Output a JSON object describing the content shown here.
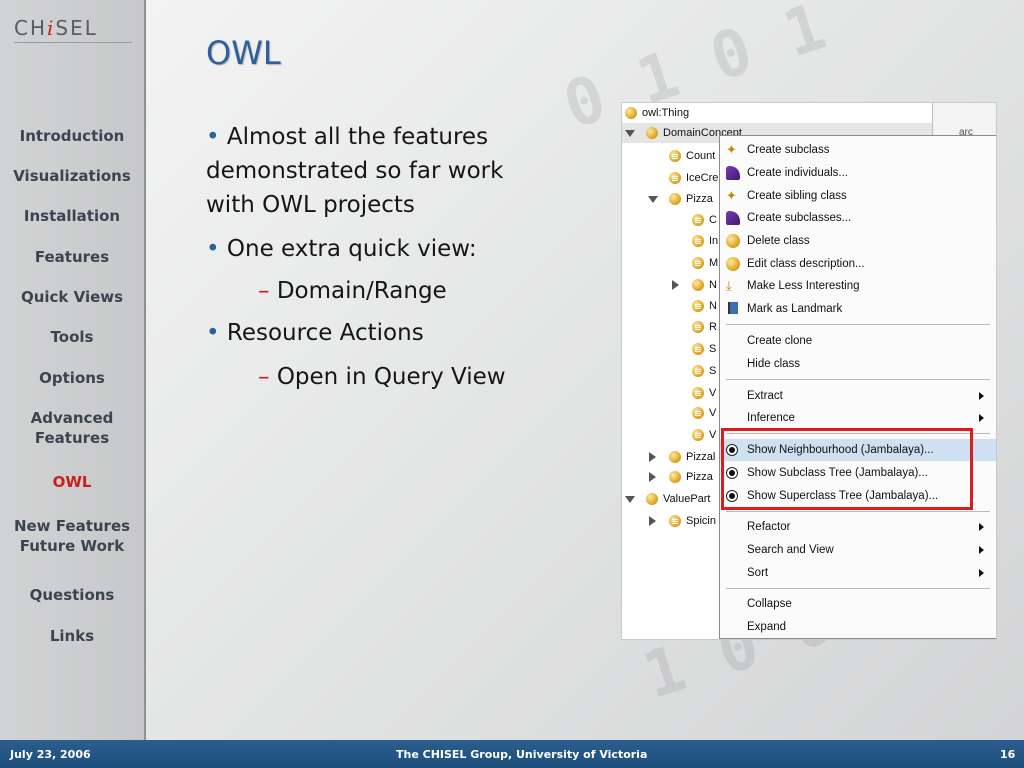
{
  "logo": {
    "text_a": "CH",
    "text_i": "i",
    "text_b": "SEL"
  },
  "sidebar": {
    "items": [
      {
        "label": "Introduction"
      },
      {
        "label": "Visualizations"
      },
      {
        "label": "Installation"
      },
      {
        "label": "Features"
      },
      {
        "label": "Quick Views"
      },
      {
        "label": "Tools"
      },
      {
        "label": "Options"
      },
      {
        "label": "Advanced Features"
      },
      {
        "label": "OWL",
        "active": true
      },
      {
        "label": "New Features Future Work"
      },
      {
        "label": "Questions"
      },
      {
        "label": "Links"
      }
    ]
  },
  "slide": {
    "title": "OWL",
    "bullets": [
      {
        "level": 1,
        "text": "Almost all the features demonstrated so far work with OWL projects"
      },
      {
        "level": 1,
        "text": "One extra quick view:"
      },
      {
        "level": 2,
        "text": "Domain/Range"
      },
      {
        "level": 1,
        "text": "Resource Actions"
      },
      {
        "level": 2,
        "text": "Open in Query View"
      }
    ],
    "bullet_glyph": "•",
    "sub_glyph": "–"
  },
  "tree": {
    "rows": [
      {
        "label": "owl:Thing",
        "expander": "none"
      },
      {
        "label": "DomainConcept",
        "expander": "down"
      },
      {
        "label": "Count",
        "expander": "none"
      },
      {
        "label": "IceCre",
        "expander": "none"
      },
      {
        "label": "Pizza",
        "expander": "down"
      },
      {
        "label": "C",
        "expander": "none"
      },
      {
        "label": "In",
        "expander": "none"
      },
      {
        "label": "M",
        "expander": "none"
      },
      {
        "label": "N",
        "expander": "right"
      },
      {
        "label": "N",
        "expander": "none"
      },
      {
        "label": "R",
        "expander": "none"
      },
      {
        "label": "S",
        "expander": "none"
      },
      {
        "label": "S",
        "expander": "none"
      },
      {
        "label": "V",
        "expander": "none"
      },
      {
        "label": "V",
        "expander": "none"
      },
      {
        "label": "V",
        "expander": "none"
      },
      {
        "label": "Pizzal",
        "expander": "right"
      },
      {
        "label": "Pizza",
        "expander": "right"
      },
      {
        "label": "ValuePart",
        "expander": "down"
      },
      {
        "label": "Spicin",
        "expander": "right"
      }
    ],
    "right_pane_text": "arc"
  },
  "context_menu": {
    "items": [
      {
        "label": "Create subclass",
        "icon": "star-ball-icon"
      },
      {
        "label": "Create individuals...",
        "icon": "wizard-hat-icon"
      },
      {
        "label": "Create sibling class",
        "icon": "star-ball-icon"
      },
      {
        "label": "Create subclasses...",
        "icon": "wizard-hat-icon"
      },
      {
        "label": "Delete class",
        "icon": "delete-ball-icon"
      },
      {
        "label": "Edit class description...",
        "icon": "ball-icon"
      },
      {
        "label": "Make Less Interesting",
        "icon": "less-interesting-icon"
      },
      {
        "label": "Mark as Landmark",
        "icon": "landmark-flag-icon"
      },
      {
        "label": "Create clone"
      },
      {
        "label": "Hide class"
      },
      {
        "label": "Extract",
        "submenu": true
      },
      {
        "label": "Inference",
        "submenu": true
      },
      {
        "label": "Show Neighbourhood (Jambalaya)...",
        "icon": "radio-icon",
        "highlighted": true
      },
      {
        "label": "Show Subclass Tree (Jambalaya)...",
        "icon": "radio-icon"
      },
      {
        "label": "Show Superclass Tree (Jambalaya)...",
        "icon": "radio-icon"
      },
      {
        "label": "Refactor",
        "submenu": true
      },
      {
        "label": "Search and View",
        "submenu": true
      },
      {
        "label": "Sort",
        "submenu": true
      },
      {
        "label": "Collapse"
      },
      {
        "label": "Expand"
      }
    ]
  },
  "footer": {
    "date": "July 23, 2006",
    "center": "The CHISEL Group, University of Victoria",
    "page": "16"
  },
  "colors": {
    "title": "#2f5f9c",
    "active_nav": "#c8201a",
    "footer_bg": "#1d4f7c",
    "highlight_box": "#e01b1b"
  }
}
